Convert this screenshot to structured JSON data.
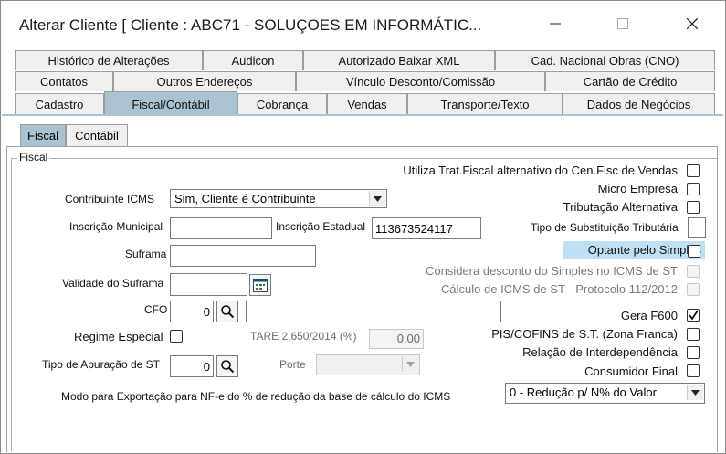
{
  "window": {
    "title": "Alterar Cliente [ Cliente : ABC71 - SOLUÇOES EM INFORMÁTIC...",
    "minimize_icon": "minimize-icon",
    "maximize_icon": "maximize-icon",
    "close_icon": "close-icon"
  },
  "tabs": {
    "row1": [
      "Histórico de Alterações",
      "Audicon",
      "Autorizado Baixar XML",
      "Cad. Nacional Obras (CNO)"
    ],
    "row2": [
      "Contatos",
      "Outros Endereços",
      "Vínculo Desconto/Comissão",
      "Cartão de Crédito"
    ],
    "row3": [
      "Cadastro",
      "Fiscal/Contábil",
      "Cobrança",
      "Vendas",
      "Transporte/Texto",
      "Dados de Negócios"
    ],
    "active": "Fiscal/Contábil"
  },
  "subtabs": [
    "Fiscal",
    "Contábil"
  ],
  "group_label": "Fiscal",
  "form": {
    "contribuinte_label": "Contribuinte ICMS",
    "contribuinte_value": "Sim, Cliente é Contribuinte",
    "inscricao_municipal_label": "Inscrição Municipal",
    "inscricao_municipal_value": "",
    "inscricao_estadual_label": "Inscrição Estadual",
    "inscricao_estadual_value": "113673524117",
    "suframa_label": "Suframa",
    "suframa_value": "",
    "validade_suframa_label": "Validade do Suframa",
    "validade_suframa_value": "",
    "cfo_label": "CFO",
    "cfo_value": "0",
    "cfo_desc": "",
    "regime_especial_label": "Regime Especial",
    "tare_label": "TARE 2.650/2014 (%)",
    "tare_value": "0,00",
    "tipo_apuracao_label": "Tipo de Apuração de ST",
    "tipo_apuracao_value": "0",
    "porte_label": "Porte",
    "porte_value": "",
    "modo_exportacao_label": "Modo para Exportação para NF-e do % de redução da base de cálculo do ICMS",
    "modo_exportacao_value": "0 - Redução p/ N% do Valor",
    "tipo_subst_label": "Tipo de Substituição Tributária",
    "tipo_subst_value": ""
  },
  "checks": [
    {
      "label": "Utiliza Trat.Fiscal alternativo do Cen.Fisc de Vendas",
      "checked": false,
      "disabled": false
    },
    {
      "label": "Micro Empresa",
      "checked": false,
      "disabled": false
    },
    {
      "label": "Tributação Alternativa",
      "checked": false,
      "disabled": false
    },
    {
      "label": "Optante pelo Simples",
      "checked": false,
      "disabled": false
    },
    {
      "label": "Considera desconto do Simples no ICMS de ST",
      "checked": false,
      "disabled": true
    },
    {
      "label": "Cálculo de ICMS de ST - Protocolo 112/2012",
      "checked": false,
      "disabled": true
    },
    {
      "label": "Gera F600",
      "checked": true,
      "disabled": false
    },
    {
      "label": "PIS/COFINS de S.T. (Zona Franca)",
      "checked": false,
      "disabled": false
    },
    {
      "label": "Relação de Interdependência",
      "checked": false,
      "disabled": false
    },
    {
      "label": "Consumidor Final",
      "checked": false,
      "disabled": false
    }
  ],
  "colors": {
    "tab_active": "#a9c3d3",
    "highlight": "#bfe0f2"
  }
}
